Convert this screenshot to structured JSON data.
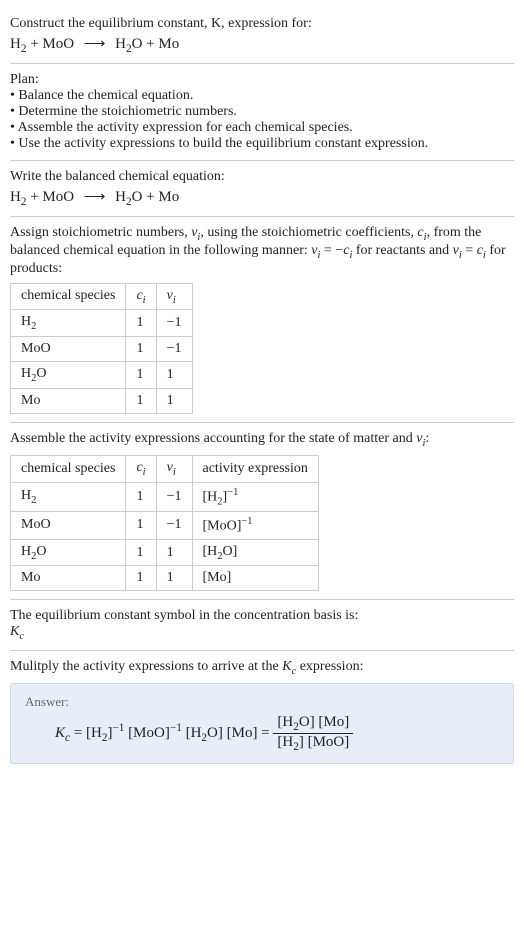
{
  "chart_data": null,
  "intro": {
    "prompt": "Construct the equilibrium constant, K, expression for:",
    "equation_html": "H<span class='sub'>2</span> + MoO <span class='arrow'>⟶</span> H<span class='sub'>2</span>O + Mo"
  },
  "plan": {
    "title": "Plan:",
    "items": [
      "Balance the chemical equation.",
      "Determine the stoichiometric numbers.",
      "Assemble the activity expression for each chemical species.",
      "Use the activity expressions to build the equilibrium constant expression."
    ]
  },
  "balanced": {
    "title": "Write the balanced chemical equation:",
    "equation_html": "H<span class='sub'>2</span> + MoO <span class='arrow'>⟶</span> H<span class='sub'>2</span>O + Mo"
  },
  "stoich": {
    "intro_html": "Assign stoichiometric numbers, <span class='ital'>ν<span class='sub'>i</span></span>, using the stoichiometric coefficients, <span class='ital'>c<span class='sub'>i</span></span>, from the balanced chemical equation in the following manner: <span class='ital'>ν<span class='sub'>i</span></span> = −<span class='ital'>c<span class='sub'>i</span></span> for reactants and <span class='ital'>ν<span class='sub'>i</span></span> = <span class='ital'>c<span class='sub'>i</span></span> for products:",
    "headers": [
      "chemical species",
      "cᵢ",
      "νᵢ"
    ],
    "rows": [
      {
        "species_html": "H<span class='sub'>2</span>",
        "ci": "1",
        "vi": "−1"
      },
      {
        "species_html": "MoO",
        "ci": "1",
        "vi": "−1"
      },
      {
        "species_html": "H<span class='sub'>2</span>O",
        "ci": "1",
        "vi": "1"
      },
      {
        "species_html": "Mo",
        "ci": "1",
        "vi": "1"
      }
    ]
  },
  "activity": {
    "title_html": "Assemble the activity expressions accounting for the state of matter and <span class='ital'>ν<span class='sub'>i</span></span>:",
    "headers": [
      "chemical species",
      "cᵢ",
      "νᵢ",
      "activity expression"
    ],
    "rows": [
      {
        "species_html": "H<span class='sub'>2</span>",
        "ci": "1",
        "vi": "−1",
        "expr_html": "[H<span class='sub'>2</span>]<span class='sup'>−1</span>"
      },
      {
        "species_html": "MoO",
        "ci": "1",
        "vi": "−1",
        "expr_html": "[MoO]<span class='sup'>−1</span>"
      },
      {
        "species_html": "H<span class='sub'>2</span>O",
        "ci": "1",
        "vi": "1",
        "expr_html": "[H<span class='sub'>2</span>O]"
      },
      {
        "species_html": "Mo",
        "ci": "1",
        "vi": "1",
        "expr_html": "[Mo]"
      }
    ]
  },
  "kc_symbol": {
    "line1": "The equilibrium constant symbol in the concentration basis is:",
    "line2_html": "<span class='Kc'>K<span class='sub'>c</span></span>"
  },
  "final": {
    "title_html": "Mulitply the activity expressions to arrive at the <span class='Kc'>K<span class='sub'>c</span></span> expression:",
    "answer_label": "Answer:",
    "formula_html": "<span class='Kc'>K<span class='sub'>c</span></span> = [H<span class='sub'>2</span>]<span class='sup'>−1</span> [MoO]<span class='sup'>−1</span> [H<span class='sub'>2</span>O] [Mo] = <span class='frac'><span class='num'>[H<span class='sub'>2</span>O] [Mo]</span><span class='den'>[H<span class='sub'>2</span>] [MoO]</span></span>"
  }
}
